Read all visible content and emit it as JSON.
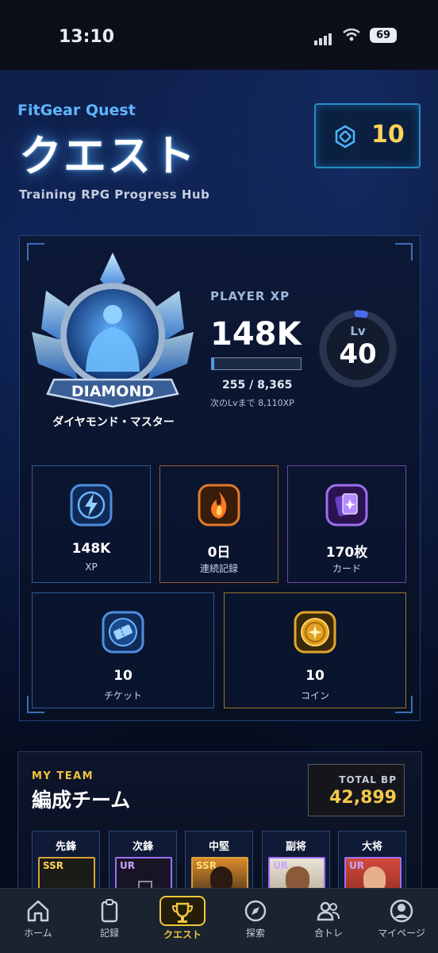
{
  "status_bar": {
    "time": "13:10",
    "battery": "69"
  },
  "header": {
    "brand": "FitGear Quest",
    "title": "クエスト",
    "subtitle": "Training RPG Progress Hub",
    "ticket_count": "10"
  },
  "player": {
    "rank_badge_text": "DIAMOND",
    "rank_name": "ダイヤモンド・マスター",
    "xp_label": "PLAYER XP",
    "xp_value": "148K",
    "progress_text": "255 / 8,365",
    "progress_fraction": 0.03,
    "next_level_text": "次のLvまで 8,110XP",
    "level_label": "Lv",
    "level": "40"
  },
  "stats": [
    {
      "value": "148K",
      "label": "XP",
      "icon": "lightning-icon",
      "color": "#3a8de0"
    },
    {
      "value": "0日",
      "label": "連続記録",
      "icon": "flame-icon",
      "color": "#f06a1a"
    },
    {
      "value": "170枚",
      "label": "カード",
      "icon": "cards-icon",
      "color": "#9c5cf0"
    },
    {
      "value": "10",
      "label": "チケット",
      "icon": "ticket-icon",
      "color": "#3c8fe6"
    },
    {
      "value": "10",
      "label": "コイン",
      "icon": "coin-icon",
      "color": "#e3a52a"
    }
  ],
  "team": {
    "kicker": "MY TEAM",
    "title": "編成チーム",
    "bp_label": "TOTAL BP",
    "bp_value": "42,899",
    "slots": [
      {
        "position": "先鋒",
        "rarity": "SSR"
      },
      {
        "position": "次鋒",
        "rarity": "UR"
      },
      {
        "position": "中堅",
        "rarity": "SSR"
      },
      {
        "position": "副将",
        "rarity": "UR"
      },
      {
        "position": "大将",
        "rarity": "UR"
      }
    ]
  },
  "tabs": [
    {
      "label": "ホーム",
      "icon": "home-icon"
    },
    {
      "label": "記録",
      "icon": "clipboard-icon"
    },
    {
      "label": "クエスト",
      "icon": "trophy-icon",
      "active": true
    },
    {
      "label": "探索",
      "icon": "compass-icon"
    },
    {
      "label": "合トレ",
      "icon": "people-icon"
    },
    {
      "label": "マイページ",
      "icon": "profile-icon"
    }
  ],
  "colors": {
    "accent": "#3aa0ff",
    "gold": "#f2c53d",
    "background": "#071027"
  }
}
